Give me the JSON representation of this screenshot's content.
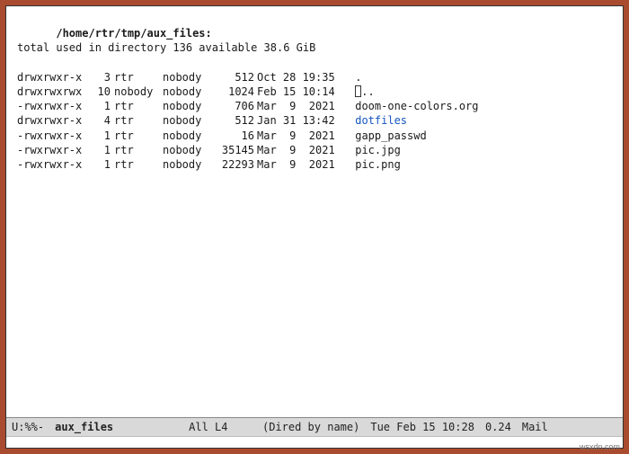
{
  "header": {
    "path": "/home/rtr/tmp/aux_files:",
    "summary": "total used in directory 136 available 38.6 GiB"
  },
  "entries": [
    {
      "perms": "drwxrwxr-x",
      "nlink": "3",
      "owner": "rtr",
      "group": "nobody",
      "size": "512",
      "date": "Oct 28 19:35",
      "name": ".",
      "is_dir": false,
      "has_cursor": false
    },
    {
      "perms": "drwxrwxrwx",
      "nlink": "10",
      "owner": "nobody",
      "group": "nobody",
      "size": "1024",
      "date": "Feb 15 10:14",
      "name": "..",
      "is_dir": false,
      "has_cursor": true
    },
    {
      "perms": "-rwxrwxr-x",
      "nlink": "1",
      "owner": "rtr",
      "group": "nobody",
      "size": "706",
      "date": "Mar  9  2021",
      "name": "doom-one-colors.org",
      "is_dir": false,
      "has_cursor": false
    },
    {
      "perms": "drwxrwxr-x",
      "nlink": "4",
      "owner": "rtr",
      "group": "nobody",
      "size": "512",
      "date": "Jan 31 13:42",
      "name": "dotfiles",
      "is_dir": true,
      "has_cursor": false
    },
    {
      "perms": "-rwxrwxr-x",
      "nlink": "1",
      "owner": "rtr",
      "group": "nobody",
      "size": "16",
      "date": "Mar  9  2021",
      "name": "gapp_passwd",
      "is_dir": false,
      "has_cursor": false
    },
    {
      "perms": "-rwxrwxr-x",
      "nlink": "1",
      "owner": "rtr",
      "group": "nobody",
      "size": "35145",
      "date": "Mar  9  2021",
      "name": "pic.jpg",
      "is_dir": false,
      "has_cursor": false
    },
    {
      "perms": "-rwxrwxr-x",
      "nlink": "1",
      "owner": "rtr",
      "group": "nobody",
      "size": "22293",
      "date": "Mar  9  2021",
      "name": "pic.png",
      "is_dir": false,
      "has_cursor": false
    }
  ],
  "modeline": {
    "left": "U:%%-",
    "buffer": "aux_files",
    "position": "All L4",
    "mode": "(Dired by name)",
    "time": "Tue Feb 15 10:28",
    "load": "0.24",
    "mail": "Mail"
  },
  "watermark": "wsxdn.com"
}
